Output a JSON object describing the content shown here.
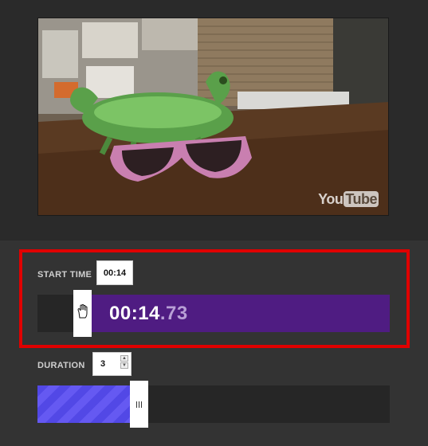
{
  "video": {
    "watermark_you": "You",
    "watermark_tube": "Tube"
  },
  "start_time": {
    "label": "START TIME",
    "chip_value": "00:14",
    "display_main": "00:14",
    "display_fraction": ".73"
  },
  "duration": {
    "label": "DURATION",
    "value": "3"
  },
  "colors": {
    "highlight": "#e00000",
    "start_fill": "#4f1c82",
    "duration_fill": "#5248e6"
  },
  "icons": {
    "start_handle": "hand-cursor-icon",
    "duration_handle": "grip-icon"
  }
}
